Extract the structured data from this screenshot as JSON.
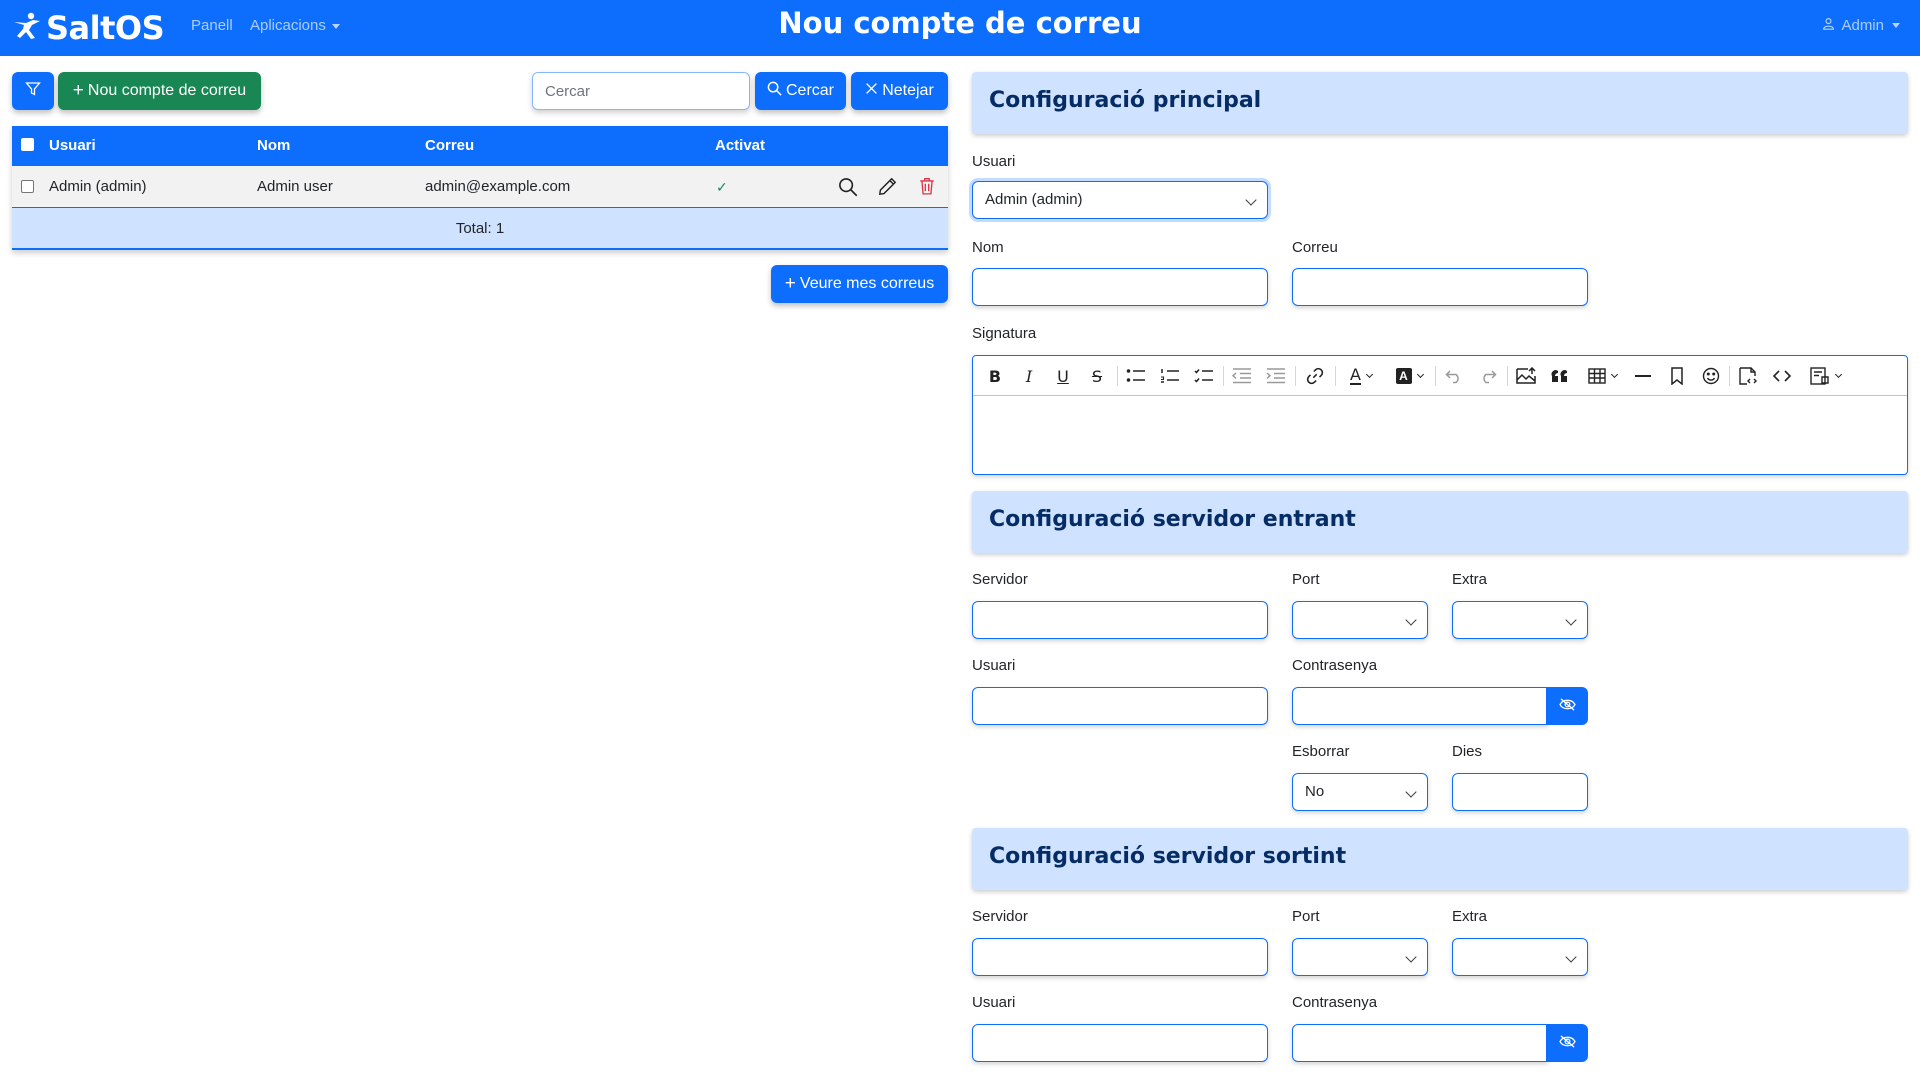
{
  "navbar": {
    "brand": "SaltOS",
    "links": {
      "panel": "Panell",
      "apps": "Aplicacions"
    },
    "title": "Nou compte de correu",
    "user": "Admin",
    "color": "#0d6efd"
  },
  "list": {
    "new_button": "Nou compte de correu",
    "search_placeholder": "Cercar",
    "search_button": "Cercar",
    "clear_button": "Netejar",
    "columns": {
      "user": "Usuari",
      "name": "Nom",
      "email": "Correu",
      "enabled": "Activat"
    },
    "rows": [
      {
        "user": "Admin (admin)",
        "name": "Admin user",
        "email": "admin@example.com",
        "enabled": "✓"
      }
    ],
    "total": "Total: 1",
    "view_mails_button": "Veure mes correus"
  },
  "form": {
    "main_section": {
      "title": "Configuració principal",
      "user_label": "Usuari",
      "user_value": "Admin (admin)",
      "name_label": "Nom",
      "email_label": "Correu",
      "signature_label": "Signatura"
    },
    "incoming_section": {
      "title": "Configuració servidor entrant",
      "server_label": "Servidor",
      "port_label": "Port",
      "extra_label": "Extra",
      "user_label": "Usuari",
      "password_label": "Contrasenya",
      "delete_label": "Esborrar",
      "delete_value": "No",
      "days_label": "Dies"
    },
    "outgoing_section": {
      "title": "Configuració servidor sortint",
      "server_label": "Servidor",
      "port_label": "Port",
      "extra_label": "Extra",
      "user_label": "Usuari",
      "password_label": "Contrasenya"
    }
  },
  "icons": {
    "filter": "filter-icon",
    "plus": "plus-icon",
    "search": "search-icon",
    "close": "x-icon",
    "view": "magnifier-icon",
    "edit": "pencil-icon",
    "delete": "trash-icon",
    "eye": "eye-slash-icon",
    "user": "person-icon"
  },
  "colors": {
    "primary": "#0d6efd",
    "success": "#198754",
    "danger": "#dc3545",
    "section_bg": "#cfe2ff",
    "section_text": "#052c65"
  }
}
